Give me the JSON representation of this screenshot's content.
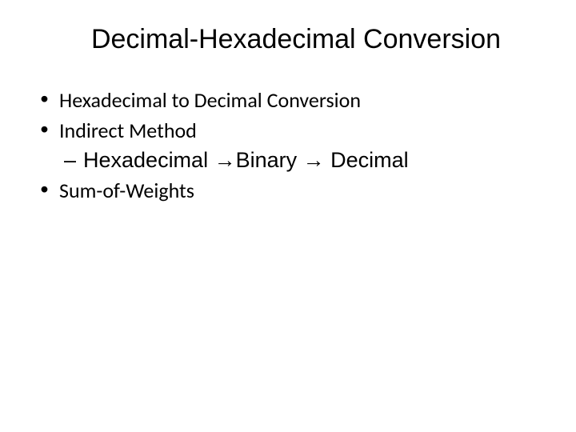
{
  "title": "Decimal-Hexadecimal Conversion",
  "bullets": {
    "item1": "Hexadecimal to Decimal Conversion",
    "item2": "Indirect Method",
    "sub1": "Hexadecimal →Binary → Decimal",
    "item3": "Sum-of-Weights"
  }
}
